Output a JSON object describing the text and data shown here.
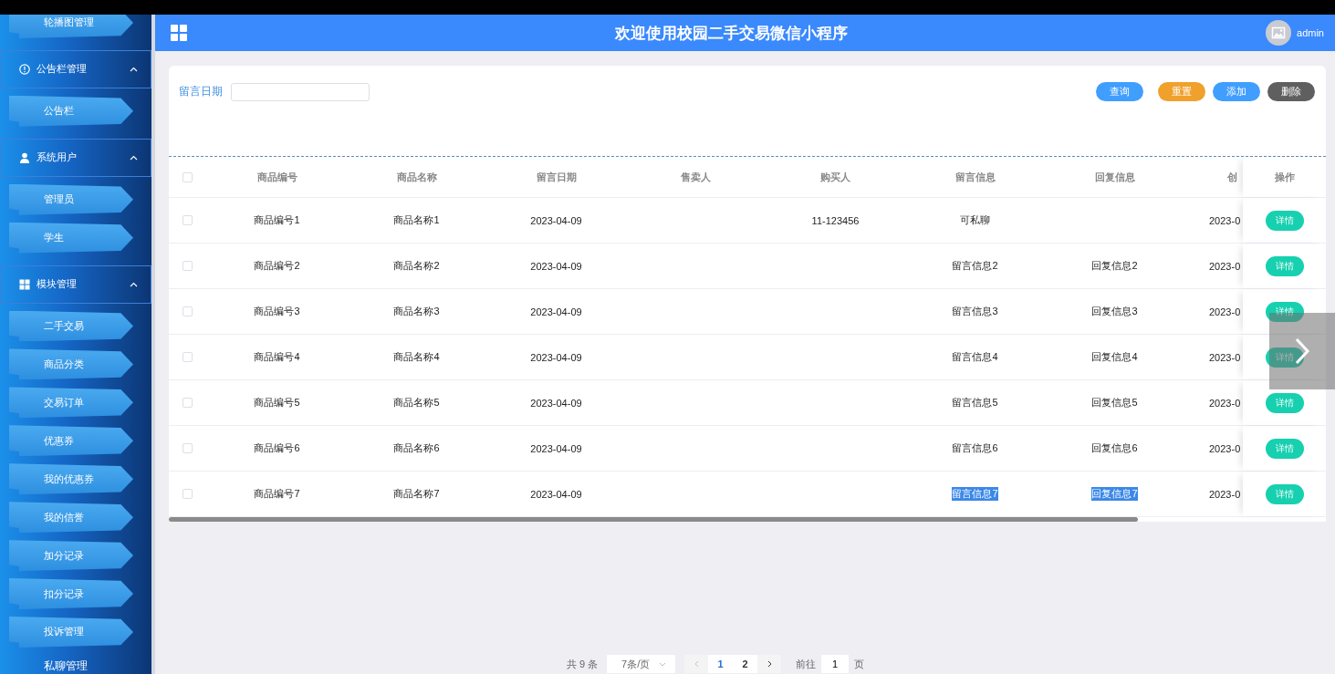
{
  "header": {
    "title": "欢迎使用校园二手交易微信小程序",
    "user": "admin"
  },
  "sidebar": {
    "items": [
      {
        "kind": "link",
        "label": "轮播图管理"
      },
      {
        "kind": "group",
        "label": "公告栏管理",
        "expanded": true,
        "children": [
          {
            "kind": "link",
            "label": "公告栏"
          }
        ]
      },
      {
        "kind": "group",
        "label": "系统用户",
        "expanded": true,
        "children": [
          {
            "kind": "link",
            "label": "管理员"
          },
          {
            "kind": "link",
            "label": "学生"
          }
        ]
      },
      {
        "kind": "group",
        "label": "模块管理",
        "expanded": true,
        "children": [
          {
            "kind": "link",
            "label": "二手交易"
          },
          {
            "kind": "link",
            "label": "商品分类"
          },
          {
            "kind": "link",
            "label": "交易订单"
          },
          {
            "kind": "link",
            "label": "优惠券"
          },
          {
            "kind": "link",
            "label": "我的优惠券"
          },
          {
            "kind": "link",
            "label": "我的信誉"
          },
          {
            "kind": "link",
            "label": "加分记录"
          },
          {
            "kind": "link",
            "label": "扣分记录"
          },
          {
            "kind": "link",
            "label": "投诉管理"
          }
        ]
      },
      {
        "kind": "plain",
        "label": "私聊管理"
      }
    ]
  },
  "search": {
    "label": "留言日期"
  },
  "buttons": [
    {
      "kind": "query",
      "label": "查询"
    },
    {
      "kind": "reset",
      "label": "重置"
    },
    {
      "kind": "add",
      "label": "添加"
    },
    {
      "kind": "delete",
      "label": "删除"
    }
  ],
  "table": {
    "header_checked": false,
    "action_column": "操作",
    "columns": [
      "商品编号",
      "商品名称",
      "留言日期",
      "售卖人",
      "购买人",
      "留言信息",
      "回复信息",
      "创"
    ],
    "rows": [
      {
        "checked": false,
        "text_selected": false,
        "cells": [
          "商品编号1",
          "商品名称1",
          "2023-04-09",
          null,
          "11-123456",
          "可私聊",
          null,
          "2023-0"
        ],
        "action": "详情"
      },
      {
        "checked": false,
        "text_selected": false,
        "cells": [
          "商品编号2",
          "商品名称2",
          "2023-04-09",
          null,
          null,
          "留言信息2",
          "回复信息2",
          "2023-0"
        ],
        "action": "详情"
      },
      {
        "checked": false,
        "text_selected": false,
        "cells": [
          "商品编号3",
          "商品名称3",
          "2023-04-09",
          null,
          null,
          "留言信息3",
          "回复信息3",
          "2023-0"
        ],
        "action": "详情"
      },
      {
        "checked": false,
        "text_selected": false,
        "cells": [
          "商品编号4",
          "商品名称4",
          "2023-04-09",
          null,
          null,
          "留言信息4",
          "回复信息4",
          "2023-0"
        ],
        "action": "详情"
      },
      {
        "checked": false,
        "text_selected": false,
        "cells": [
          "商品编号5",
          "商品名称5",
          "2023-04-09",
          null,
          null,
          "留言信息5",
          "回复信息5",
          "2023-0"
        ],
        "action": "详情"
      },
      {
        "checked": false,
        "text_selected": false,
        "cells": [
          "商品编号6",
          "商品名称6",
          "2023-04-09",
          null,
          null,
          "留言信息6",
          "回复信息6",
          "2023-0"
        ],
        "action": "详情"
      },
      {
        "checked": false,
        "text_selected": true,
        "cells": [
          "商品编号7",
          "商品名称7",
          "2023-04-09",
          null,
          null,
          "留言信息7",
          "回复信息7",
          "2023-0"
        ],
        "action": "详情"
      }
    ]
  },
  "pagination": {
    "total": "共 9 条",
    "page_size": "7条/页",
    "pages": [
      {
        "label": "1",
        "selected": true
      },
      {
        "label": "2",
        "selected": false
      }
    ],
    "goto_label": "前往",
    "goto_value": "1",
    "goto_suffix": "页"
  }
}
